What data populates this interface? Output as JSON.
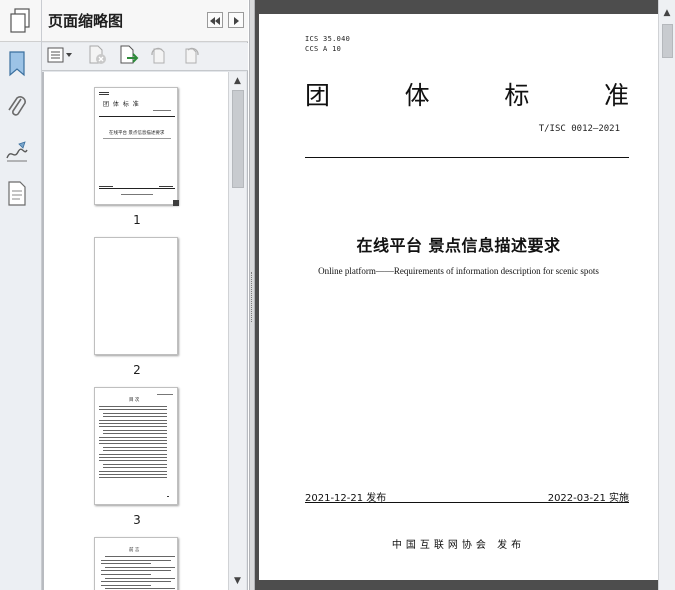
{
  "panel": {
    "title": "页面缩略图",
    "thumbnails": [
      {
        "label": "1"
      },
      {
        "label": "2"
      },
      {
        "label": "3"
      }
    ]
  },
  "document": {
    "ics": "ICS  35.040",
    "ccs": "CCS  A  10",
    "standard_chars": [
      "团",
      "体",
      "标",
      "准"
    ],
    "standard_number": "T/ISC 0012—2021",
    "title_cn": "在线平台  景点信息描述要求",
    "title_en": "Online platform——Requirements of information description for scenic spots",
    "issue_date": "2021-12-21 发布",
    "effective_date": "2022-03-21 实施",
    "publisher": "中国互联网协会    发布"
  },
  "mini_page1": {
    "title": "团    体    标    准",
    "name": "在线平台 景点信息描述要求"
  },
  "mini_page3": {
    "heading": "目    次"
  },
  "mini_page4": {
    "heading": "前    言"
  },
  "icons": [
    "pages-icon",
    "bookmark-icon",
    "attachment-icon",
    "signature-icon",
    "document-icon",
    "first-page-icon",
    "collapse-icon",
    "options-icon",
    "delete-icon",
    "extract-icon",
    "rotate-ccw-icon",
    "rotate-cw-icon"
  ],
  "colors": {
    "viewport_bg": "#4d4d4d",
    "panel_bg": "#e3e6ea",
    "rail_bg": "#eceff3"
  }
}
